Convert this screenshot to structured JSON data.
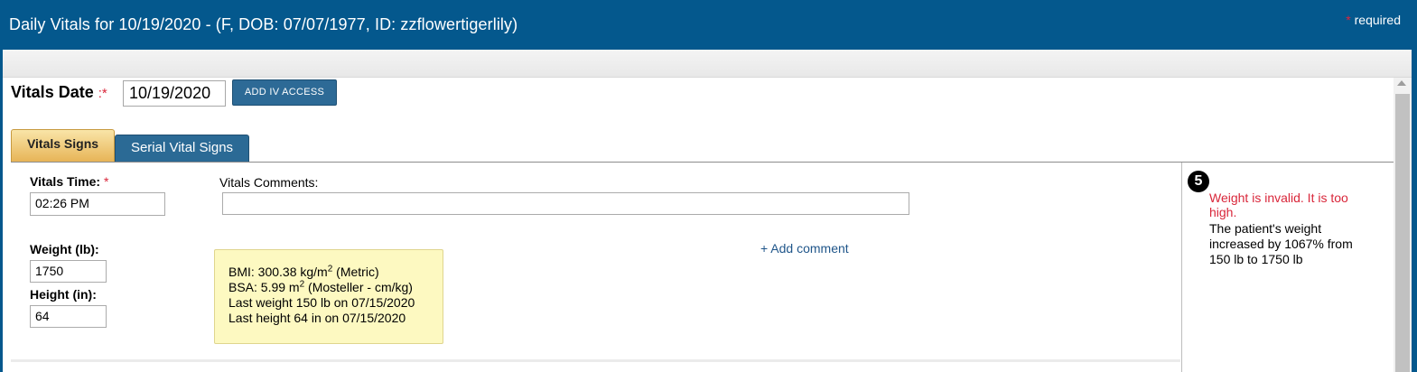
{
  "header": {
    "title": "Daily Vitals for 10/19/2020 - (F, DOB: 07/07/1977, ID: zzflowertigerlily)",
    "required_star": "*",
    "required_text": "required"
  },
  "vitals_date": {
    "label": "Vitals Date",
    "separator": ":",
    "star": "*",
    "value": "10/19/2020"
  },
  "toolbar": {
    "add_iv_label": "ADD IV ACCESS"
  },
  "tabs": [
    {
      "label": "Vitals Signs",
      "active": true
    },
    {
      "label": "Serial Vital Signs",
      "active": false
    }
  ],
  "form": {
    "time_label": "Vitals Time:",
    "time_star": "*",
    "time_value": "02:26 PM",
    "comments_label": "Vitals Comments:",
    "comments_value": "",
    "weight_label": "Weight (lb):",
    "weight_value": "1750",
    "height_label": "Height (in):",
    "height_value": "64",
    "add_comment": "+ Add comment"
  },
  "info": {
    "bmi_prefix": "BMI: 300.38 kg/m",
    "bmi_exp": "2",
    "bmi_suffix": " (Metric)",
    "bsa_prefix": "BSA: 5.99 m",
    "bsa_exp": "2",
    "bsa_suffix": " (Mosteller - cm/kg)",
    "last_weight": "Last weight 150 lb on 07/15/2020",
    "last_height": "Last height 64 in on 07/15/2020"
  },
  "alert": {
    "number": "5",
    "error": "Weight is invalid. It is too high.",
    "detail": "The patient's weight increased by 1067% from 150 lb to 1750 lb"
  },
  "colors": {
    "header_bg": "#04588d",
    "required_star": "#e0243a",
    "error_text": "#d9263a",
    "button_bg": "#2d6a96",
    "active_tab": "#e7b457",
    "info_bg": "#fdf9c1"
  }
}
